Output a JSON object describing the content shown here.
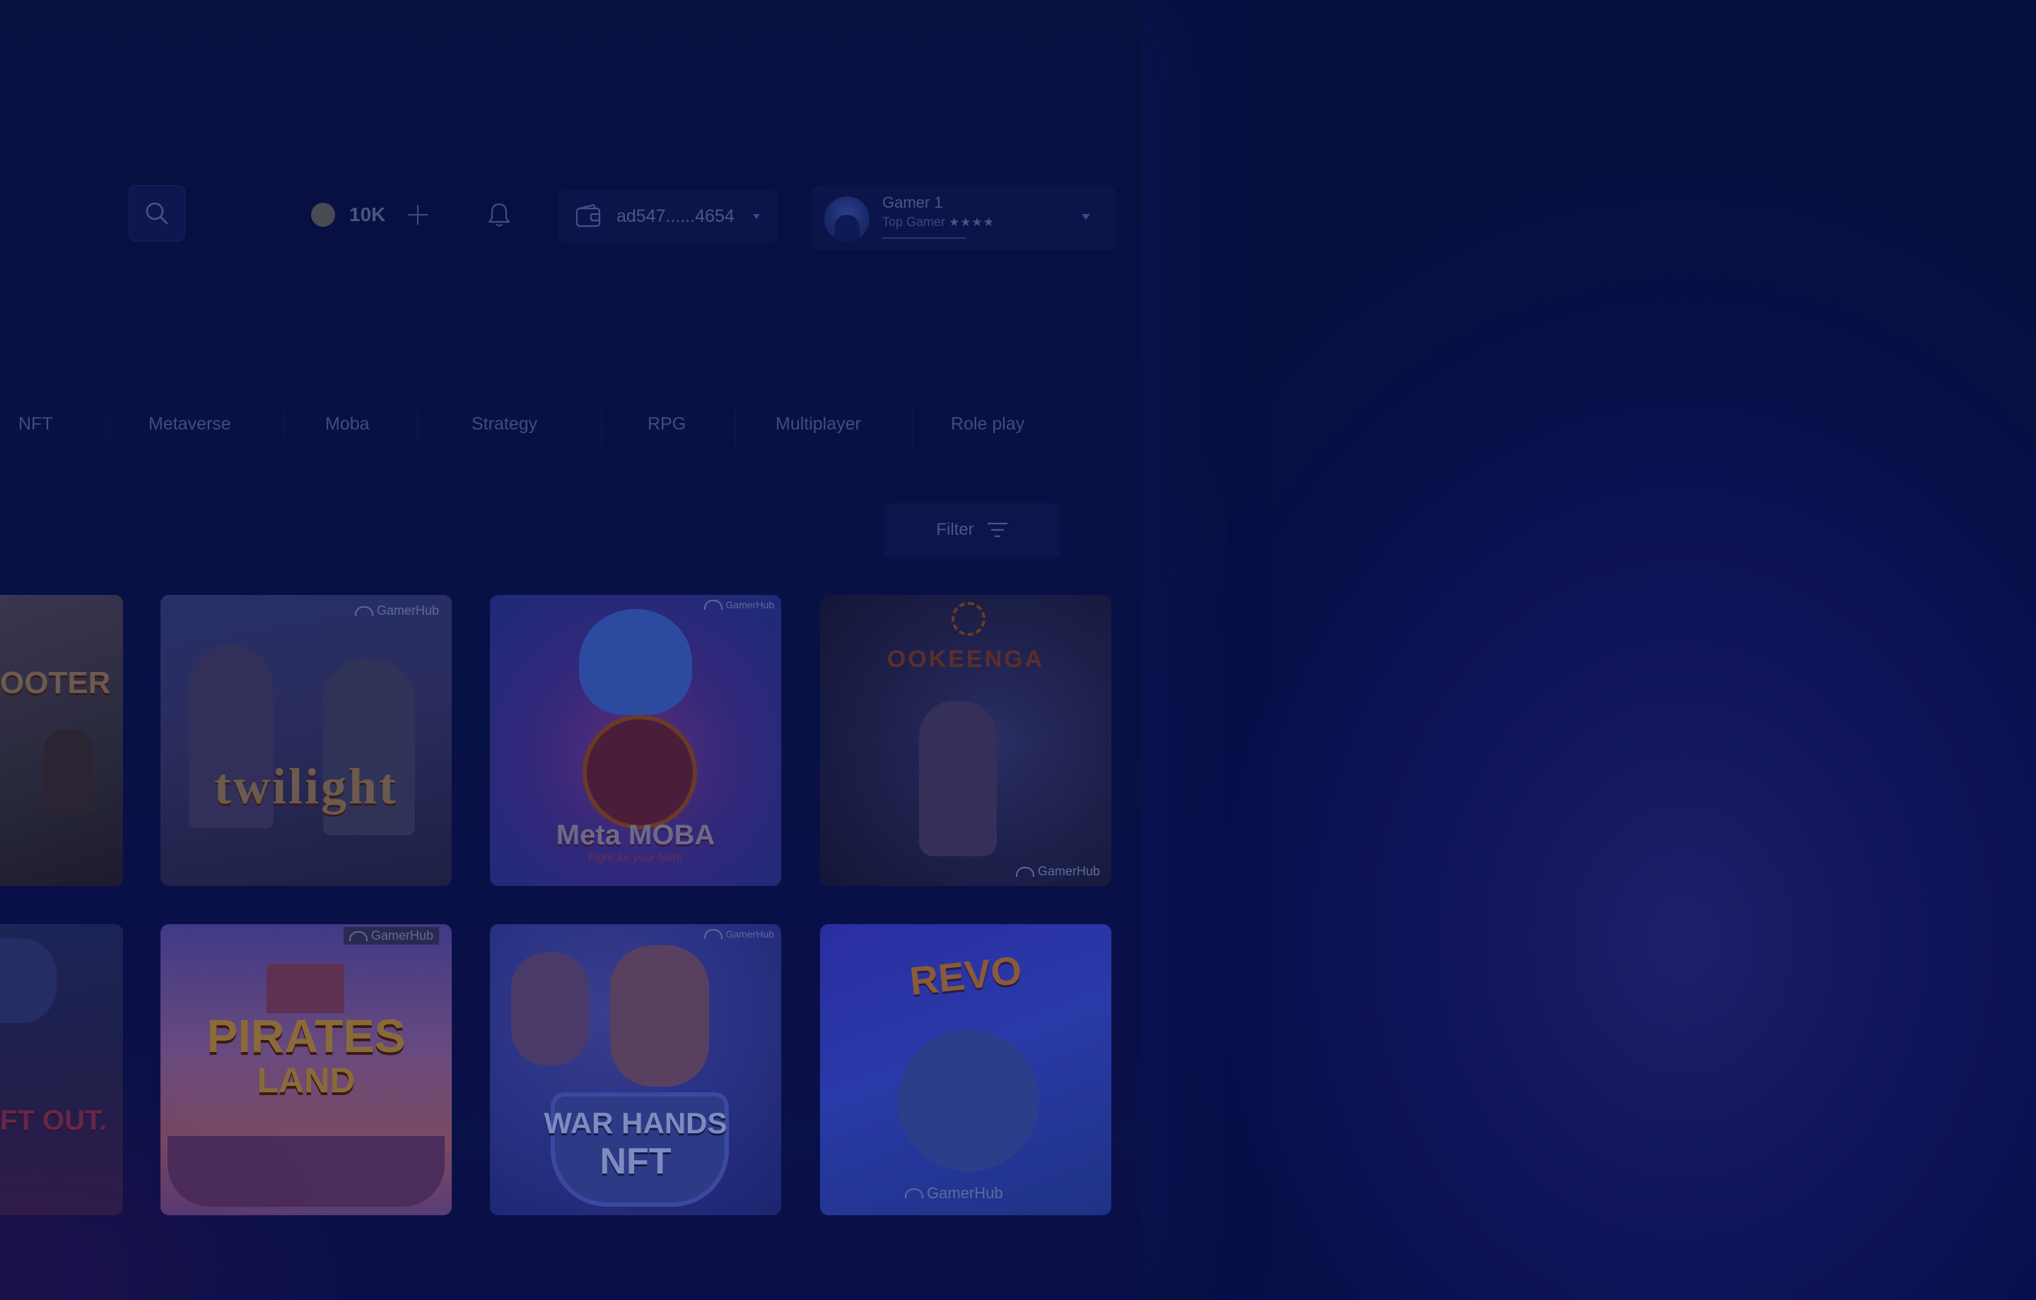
{
  "header": {
    "coins": "10K",
    "wallet_address": "ad547......4654",
    "profile": {
      "name": "Gamer 1",
      "rank": "Top Gamer",
      "stars": "★★★★"
    }
  },
  "categories": [
    "NFT",
    "Metaverse",
    "Moba",
    "Strategy",
    "RPG",
    "Multiplayer",
    "Role play"
  ],
  "filter_label": "Filter",
  "games": [
    {
      "title": "OOTER"
    },
    {
      "title": "twilight",
      "badge": "GamerHub"
    },
    {
      "title": "Meta MOBA",
      "subtitle": "Fight for your faith!",
      "badge": "GamerHub"
    },
    {
      "title": "OOKEENGA",
      "badge": "GamerHub"
    },
    {
      "title": "FT OUT."
    },
    {
      "title": "PIRATES",
      "title2": "LAND",
      "badge": "GamerHub"
    },
    {
      "title": "WAR HANDS",
      "title2": "NFT",
      "badge": "GamerHub"
    },
    {
      "title": "REVO",
      "badge": "GamerHub"
    }
  ],
  "colors": {
    "background": "#070f48",
    "panel": "#0b1549",
    "text_dim": "#414c82"
  }
}
